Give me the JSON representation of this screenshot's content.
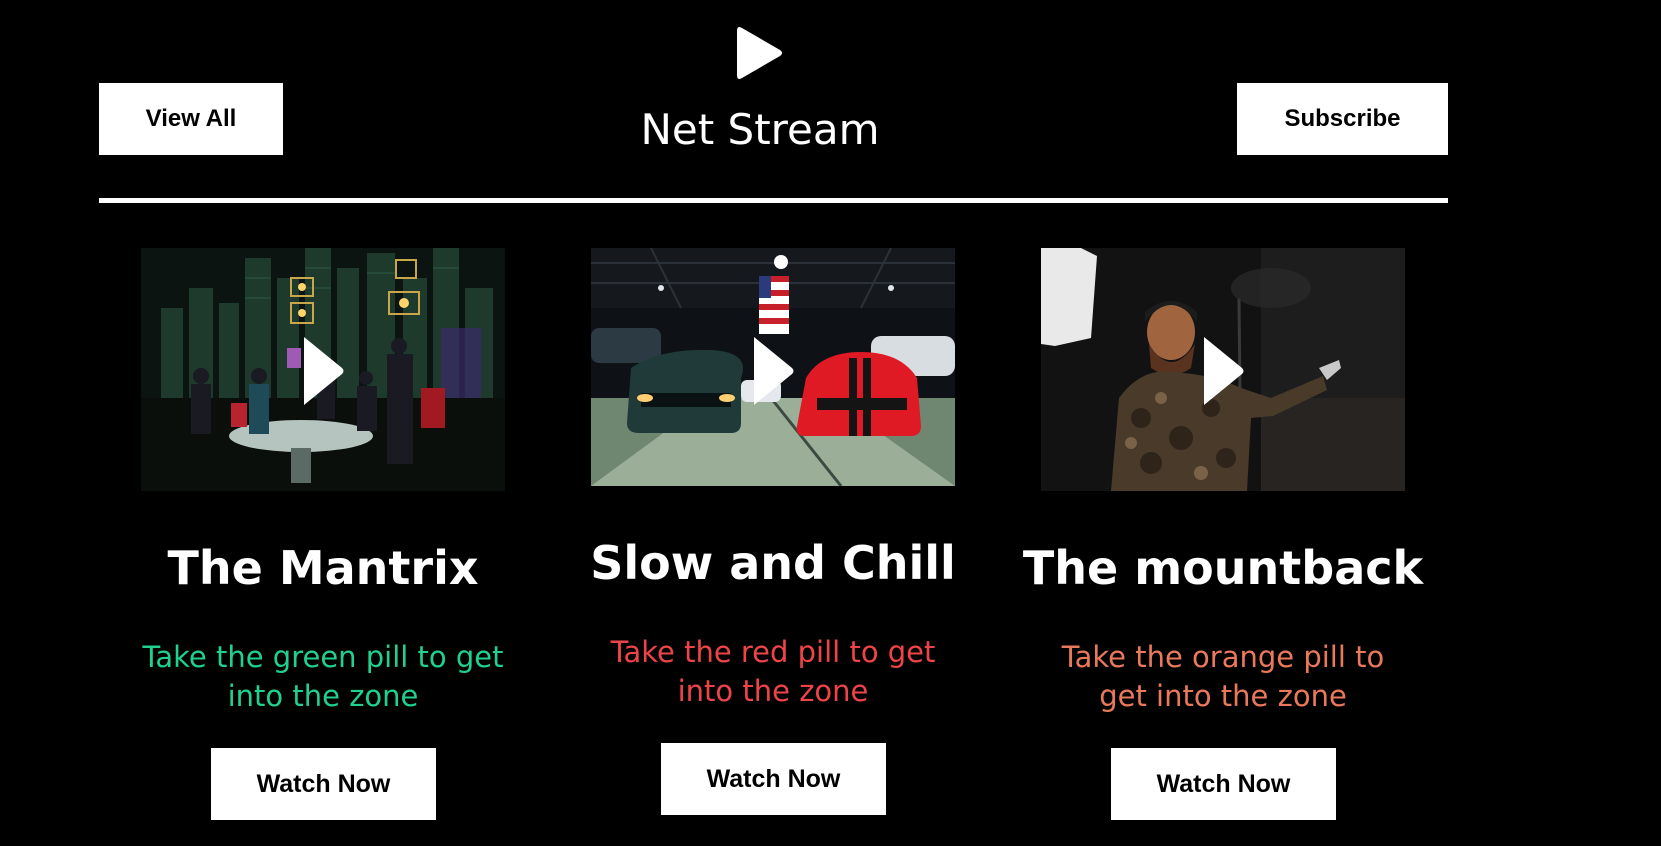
{
  "header": {
    "brand": "Net Stream",
    "view_all_label": "View All",
    "subscribe_label": "Subscribe"
  },
  "cards": [
    {
      "title": "The Mantrix",
      "description": "Take the green pill to get into the zone",
      "accent": "#1fd08e",
      "button_label": "Watch Now"
    },
    {
      "title": "Slow and Chill",
      "description": "Take the red pill to get into the zone",
      "accent": "#ee4448",
      "button_label": "Watch Now"
    },
    {
      "title": "The mountback",
      "description": "Take the orange pill to get into the zone",
      "accent": "#e9795a",
      "button_label": "Watch Now"
    }
  ],
  "icons": {
    "logo": "play-icon",
    "thumbnail_overlay": "play-icon"
  }
}
